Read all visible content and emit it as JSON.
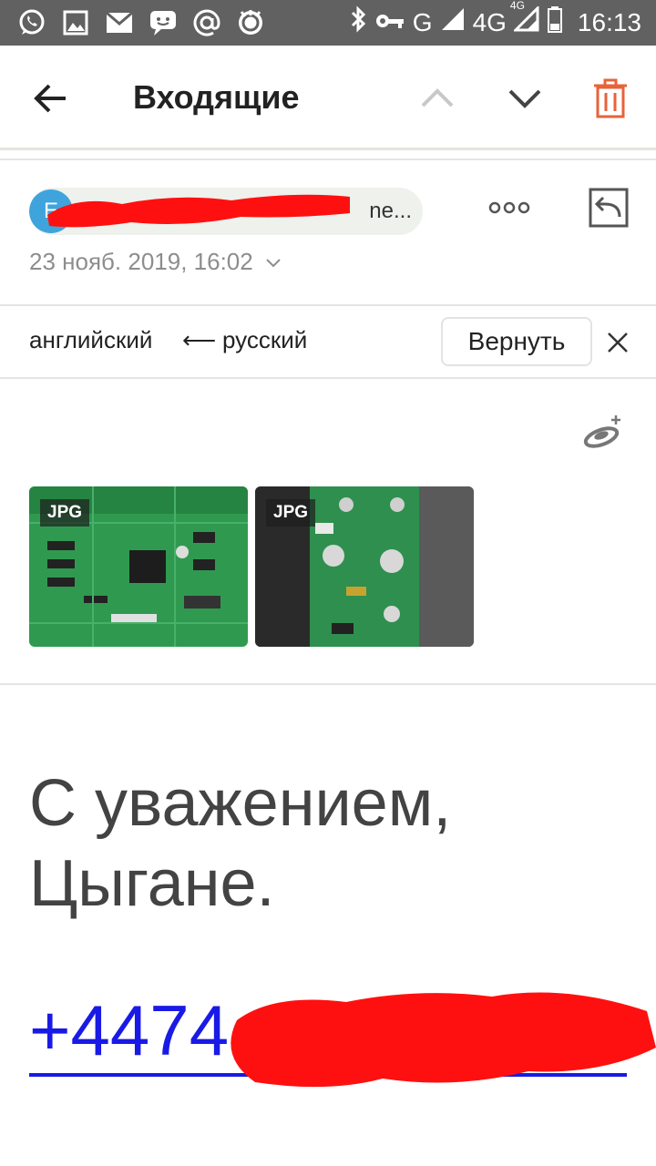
{
  "status_bar": {
    "network_g": "G",
    "network_4g": "4G",
    "network_4g_small": "4G",
    "time": "16:13",
    "notification_icons": [
      "whatsapp-icon",
      "gallery-icon",
      "mail-icon",
      "chat-icon",
      "at-icon",
      "dr-web-icon"
    ],
    "system_icons": [
      "bluetooth-icon",
      "key-icon",
      "signal-icon",
      "signal-icon",
      "battery-icon"
    ]
  },
  "toolbar": {
    "title": "Входящие",
    "accent_color": "#e8623a"
  },
  "message": {
    "sender_initial": "E",
    "sender_text": "ne...",
    "date": "23 нояб. 2019, 16:02"
  },
  "translation": {
    "from_lang": "английский",
    "arrow": "⟵",
    "to_lang": "русский",
    "revert_label": "Вернуть"
  },
  "attachments": [
    {
      "type_badge": "JPG"
    },
    {
      "type_badge": "JPG"
    }
  ],
  "body": {
    "signature_line1": "С уважением,",
    "signature_line2": "Цыгане.",
    "phone_visible": "+4474"
  }
}
